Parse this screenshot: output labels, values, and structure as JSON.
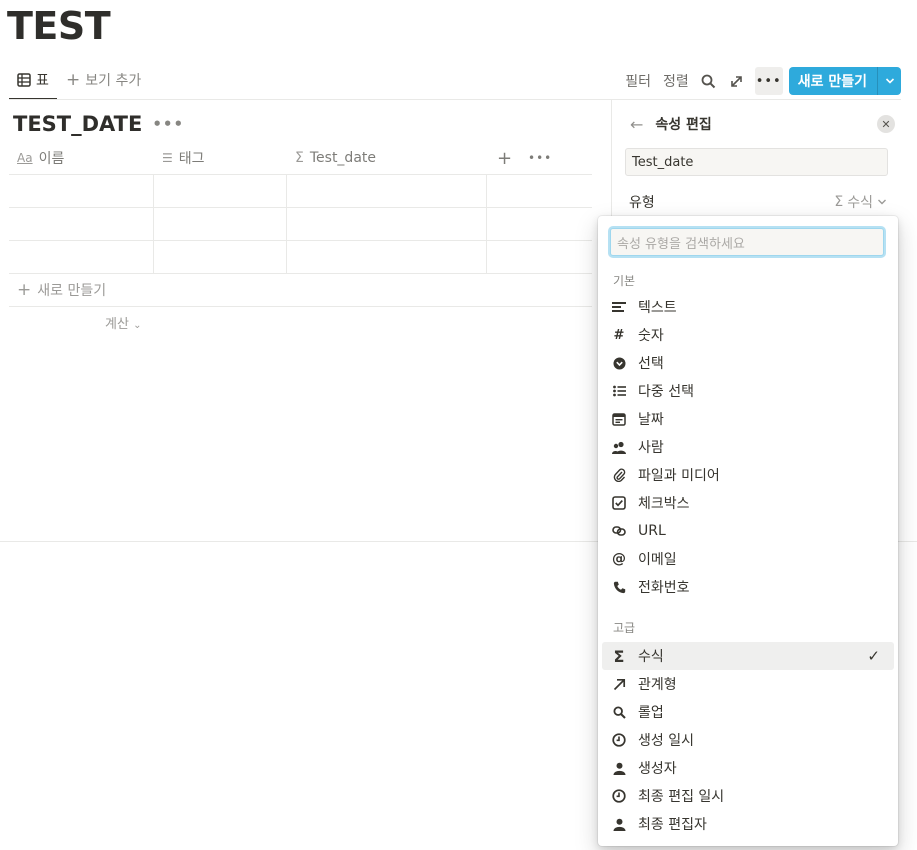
{
  "page": {
    "title": "TEST"
  },
  "viewbar": {
    "tab_label": "표",
    "add_view_label": "보기 추가",
    "filter_label": "필터",
    "sort_label": "정렬",
    "new_button_label": "새로 만들기"
  },
  "database": {
    "title": "TEST_DATE",
    "columns": [
      {
        "label": "이름",
        "icon": "text-aa-icon"
      },
      {
        "label": "태그",
        "icon": "list-icon"
      },
      {
        "label": "Test_date",
        "icon": "sigma-icon"
      }
    ],
    "new_row_label": "새로 만들기",
    "calc_label": "계산"
  },
  "side_panel": {
    "title": "속성 편집",
    "property_name": "Test_date",
    "type_label": "유형",
    "type_value": "수식"
  },
  "dropdown": {
    "search_placeholder": "속성 유형을 검색하세요",
    "basic_section": "기본",
    "advanced_section": "고급",
    "basic_items": [
      {
        "label": "텍스트",
        "icon": "text-lines-icon"
      },
      {
        "label": "숫자",
        "icon": "hash-icon"
      },
      {
        "label": "선택",
        "icon": "select-icon"
      },
      {
        "label": "다중 선택",
        "icon": "multi-select-icon"
      },
      {
        "label": "날짜",
        "icon": "calendar-icon"
      },
      {
        "label": "사람",
        "icon": "people-icon"
      },
      {
        "label": "파일과 미디어",
        "icon": "paperclip-icon"
      },
      {
        "label": "체크박스",
        "icon": "checkbox-icon"
      },
      {
        "label": "URL",
        "icon": "link-icon"
      },
      {
        "label": "이메일",
        "icon": "at-icon"
      },
      {
        "label": "전화번호",
        "icon": "phone-icon"
      }
    ],
    "advanced_items": [
      {
        "label": "수식",
        "icon": "sigma-icon",
        "selected": true
      },
      {
        "label": "관계형",
        "icon": "arrow-up-right-icon"
      },
      {
        "label": "롤업",
        "icon": "search-icon"
      },
      {
        "label": "생성 일시",
        "icon": "clock-icon"
      },
      {
        "label": "생성자",
        "icon": "person-icon"
      },
      {
        "label": "최종 편집 일시",
        "icon": "clock-icon"
      },
      {
        "label": "최종 편집자",
        "icon": "person-icon"
      }
    ]
  },
  "colors": {
    "accent": "#2eaadc",
    "text": "#37352f",
    "selected_bg": "#efefee"
  }
}
